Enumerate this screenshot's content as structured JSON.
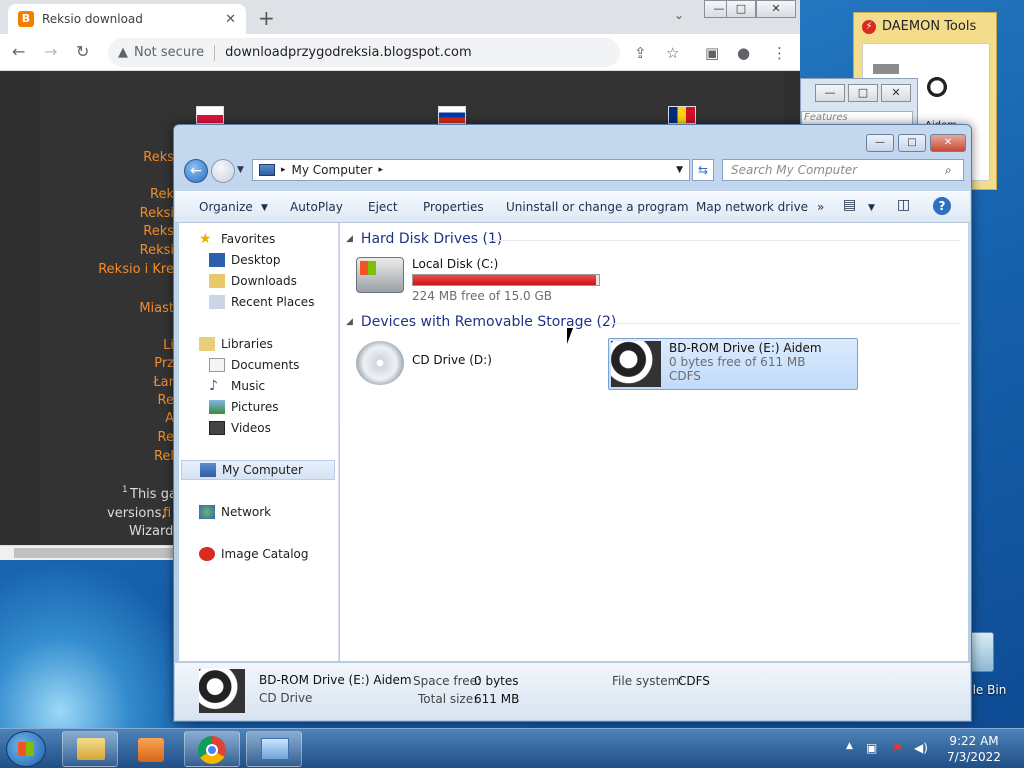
{
  "browser": {
    "tab_title": "Reksio download",
    "tab_close": "✕",
    "new_tab": "+",
    "tab_dropdown": "⌄",
    "security_label": "Not secure",
    "url": "downloadprzygodreksia.blogspot.com",
    "page_links": [
      "Reks",
      "Rek",
      "Reksi",
      "Reks",
      "Reksi",
      "Reksio i Kre",
      "Miast",
      "Li",
      "Prz",
      "Łar",
      "Re",
      "A",
      "Re",
      "Rel"
    ],
    "footnote_marker": "1",
    "footnote_line1": "This ga",
    "footnote_line2": "versions,",
    "footnote_link": "fi",
    "footnote_line3": "Wizards"
  },
  "daemon": {
    "title": "DAEMON Tools",
    "bg_search": "Features",
    "label": "Aidem"
  },
  "explorer": {
    "window_controls": {
      "minimize": "—",
      "maximize": "□",
      "close": "✕"
    },
    "address": "My Computer",
    "address_arrow": "▸",
    "search_placeholder": "Search My Computer",
    "toolbar": {
      "organize": "Organize",
      "autoplay": "AutoPlay",
      "eject": "Eject",
      "properties": "Properties",
      "uninstall": "Uninstall or change a program",
      "map_drive": "Map network drive",
      "more": "»",
      "help": "?"
    },
    "nav": {
      "favorites": "Favorites",
      "desktop": "Desktop",
      "downloads": "Downloads",
      "recent": "Recent Places",
      "libraries": "Libraries",
      "documents": "Documents",
      "music": "Music",
      "pictures": "Pictures",
      "videos": "Videos",
      "my_computer": "My Computer",
      "network": "Network",
      "image_catalog": "Image Catalog"
    },
    "groups": {
      "hdd": "Hard Disk Drives (1)",
      "removable": "Devices with Removable Storage (2)"
    },
    "drives": {
      "c_name": "Local Disk (C:)",
      "c_free": "224 MB free of 15.0 GB",
      "c_used_fraction": 0.985,
      "d_name": "CD Drive (D:)",
      "e_name": "BD-ROM Drive (E:) Aidem",
      "e_free": "0 bytes free of 611 MB",
      "e_fs": "CDFS"
    },
    "details": {
      "name": "BD-ROM Drive (E:) Aidem",
      "type": "CD Drive",
      "space_free_label": "Space free:",
      "space_free": "0 bytes",
      "total_label": "Total size:",
      "total": "611 MB",
      "fs_label": "File system:",
      "fs": "CDFS"
    }
  },
  "taskbar": {
    "time": "9:22 AM",
    "date": "7/3/2022",
    "recycle_label": "cle Bin"
  },
  "colors": {
    "accent_orange": "#f28c28",
    "bar_red": "#d81e1e",
    "selection_blue": "#c1dbfb"
  }
}
